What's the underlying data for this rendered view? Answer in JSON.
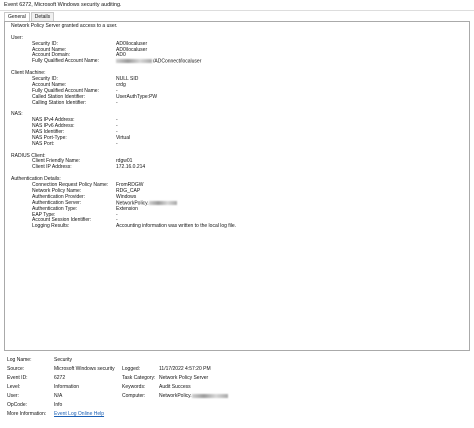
{
  "window": {
    "title": "Event 6272, Microsoft Windows security auditing."
  },
  "tabs": [
    "General",
    "Details"
  ],
  "description": {
    "intro": "Network Policy Server granted access to a user.",
    "user": {
      "heading": "User:",
      "security_id_label": "Security ID:",
      "security_id": "AD0\\localuser",
      "account_name_label": "Account Name:",
      "account_name": "AD0\\localuser",
      "account_domain_label": "Account Domain:",
      "account_domain": "AD0",
      "fqan_label": "Fully Qualified Account Name:",
      "fqan_suffix": "/ADConnect/localuser"
    },
    "client_machine": {
      "heading": "Client Machine:",
      "security_id_label": "Security ID:",
      "security_id": "NULL SID",
      "account_name_label": "Account Name:",
      "account_name": "crdg",
      "fqan_label": "Fully Qualified Account Name:",
      "fqan": "-",
      "called_station_label": "Called Station Identifier:",
      "called_station": "UserAuthType:PW",
      "calling_station_label": "Calling Station Identifier:",
      "calling_station": "-"
    },
    "nas": {
      "heading": "NAS:",
      "ipv4_label": "NAS IPv4 Address:",
      "ipv4": "-",
      "ipv6_label": "NAS IPv6 Address:",
      "ipv6": "-",
      "identifier_label": "NAS Identifier:",
      "identifier": "-",
      "port_type_label": "NAS Port-Type:",
      "port_type": "Virtual",
      "port_label": "NAS Port:",
      "port": "-"
    },
    "radius_client": {
      "heading": "RADIUS Client:",
      "friendly_name_label": "Client Friendly Name:",
      "friendly_name": "rdgw01",
      "ip_label": "Client IP Address:",
      "ip": "172.16.0.214"
    },
    "auth_details": {
      "heading": "Authentication Details:",
      "crp_label": "Connection Request Policy Name:",
      "crp": "FromRDGW",
      "np_label": "Network Policy Name:",
      "np": "RDG_CAP",
      "provider_label": "Authentication Provider:",
      "provider": "Windows",
      "server_label": "Authentication Server:",
      "server_prefix": "NetworkPolicy.",
      "type_label": "Authentication Type:",
      "type": "Extension",
      "eap_label": "EAP Type:",
      "eap": "-",
      "session_label": "Account Session Identifier:",
      "session": "-",
      "logging_label": "Logging Results:",
      "logging": "Accounting information was written to the local log file."
    }
  },
  "meta": {
    "log_name_label": "Log Name:",
    "log_name": "Security",
    "source_label": "Source:",
    "source": "Microsoft Windows security",
    "logged_label": "Logged:",
    "logged": "11/17/2022 4:57:20 PM",
    "event_id_label": "Event ID:",
    "event_id": "6272",
    "task_label": "Task Category:",
    "task": "Network Policy Server",
    "level_label": "Level:",
    "level": "Information",
    "keywords_label": "Keywords:",
    "keywords": "Audit Success",
    "user_label": "User:",
    "user": "N/A",
    "computer_label": "Computer:",
    "computer_prefix": "NetworkPolicy.",
    "opcode_label": "OpCode:",
    "opcode": "Info",
    "more_info_label": "More Information:",
    "more_info_link": "Event Log Online Help"
  }
}
